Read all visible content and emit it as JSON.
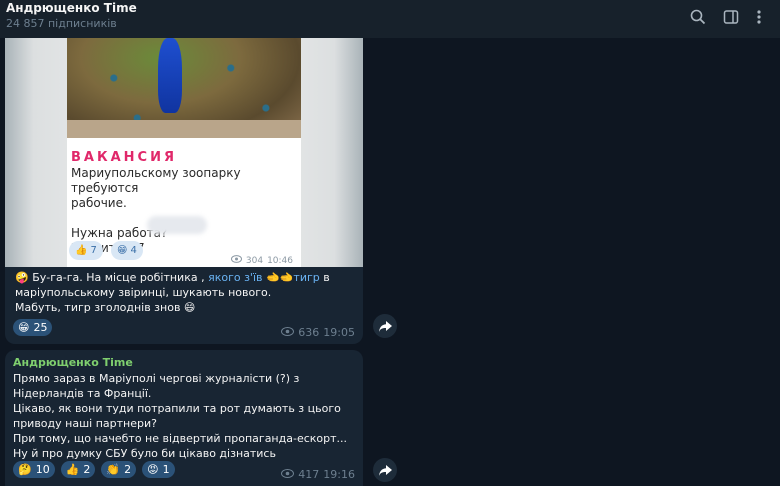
{
  "header": {
    "title": "Андрющенко Time",
    "subscribers": "24 857 підписників"
  },
  "post1": {
    "image": {
      "vacancy_title": "ВАКАНСИЯ",
      "vacancy_text": "Мариупольскому зоопарку требуются\nрабочие.\n\nНужна работа?\nЗвоните +7",
      "reactions": [
        {
          "emoji": "👍",
          "count": "7"
        },
        {
          "emoji": "😁",
          "count": "4"
        }
      ],
      "views": "304",
      "time": "10:46"
    },
    "caption_before_link": "Бу-га-га. На місце робітника , ",
    "caption_link": "якого з'їв",
    "caption_link_tail": "тигр",
    "caption_after_link": " в маріупольському звіринці, шукають нового.",
    "caption_line2": "Мабуть, тигр зголоднів знов 😄",
    "caption_emoji": "🤪",
    "hand_emoji": "🫲🫲",
    "reaction": {
      "emoji": "😁",
      "count": "25"
    },
    "views": "636",
    "time": "19:05"
  },
  "post2": {
    "author": "Андрющенко Time",
    "text": "Прямо зараз в Маріуполі чергові журналісти (?) з Нідерландів та Франції.\nЦікаво, як вони туди потрапили та рот думають з цього приводу наші партнери?\nПри тому, що начебто не відвертий пропаганда-ескорт...\nНу й про думку СБУ було би цікаво дізнатись",
    "reactions": [
      {
        "emoji": "🤔",
        "count": "10"
      },
      {
        "emoji": "👍",
        "count": "2"
      },
      {
        "emoji": "👏",
        "count": "2"
      },
      {
        "emoji": "😡",
        "count": "1"
      }
    ],
    "views": "417",
    "time": "19:16"
  },
  "colors": {
    "background": "#0e1621",
    "bubble": "#182533",
    "link": "#6ab3f3",
    "author": "#7fcf6e",
    "accent_vacancy": "#e0286a"
  },
  "icons": [
    "search-icon",
    "sidebar-toggle-icon",
    "more-vert-icon",
    "eye-icon",
    "share-icon"
  ]
}
